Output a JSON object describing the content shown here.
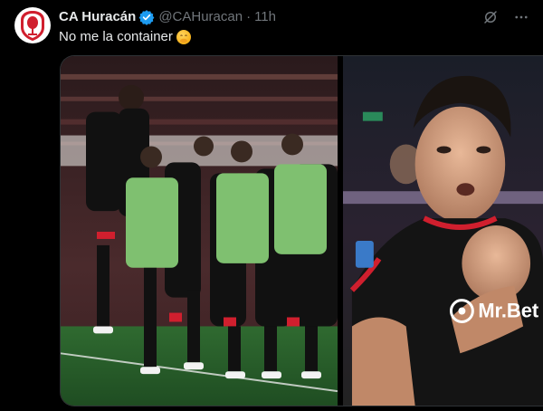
{
  "tweet": {
    "display_name": "CA Huracán",
    "handle": "@CAHuracan",
    "separator": "·",
    "time": "11h",
    "text": "No me la container",
    "emoji": "face-with-hand-over-mouth"
  },
  "icons": {
    "verified": "verified-badge-icon",
    "grok": "grok-icon",
    "more": "more-options-icon"
  },
  "photo_2": {
    "sponsor_text": "Mr.Bet"
  },
  "colors": {
    "background": "#000000",
    "text_primary": "#e7e9ea",
    "text_secondary": "#71767b",
    "verified_blue": "#1d9bf0",
    "club_red": "#d01f2e",
    "pitch_green": "#2f7a35"
  }
}
